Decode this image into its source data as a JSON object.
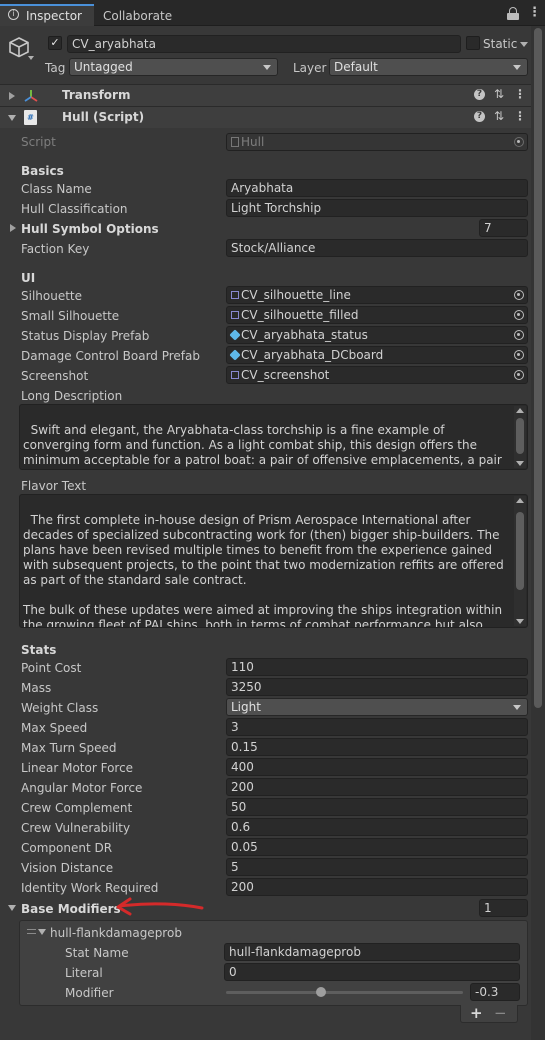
{
  "tabs": {
    "inspector": "Inspector",
    "collaborate": "Collaborate"
  },
  "object": {
    "name": "CV_aryabhata",
    "static_label": "Static",
    "tag_label": "Tag",
    "tag_value": "Untagged",
    "layer_label": "Layer",
    "layer_value": "Default"
  },
  "components": {
    "transform": "Transform",
    "hull_script": "Hull (Script)"
  },
  "script": {
    "label": "Script",
    "value": "Hull"
  },
  "basics": {
    "header": "Basics",
    "class_name_label": "Class Name",
    "class_name_value": "Aryabhata",
    "hull_class_label": "Hull Classification",
    "hull_class_value": "Light Torchship",
    "symbol_label": "Hull Symbol Options",
    "symbol_value": "7",
    "faction_label": "Faction Key",
    "faction_value": "Stock/Alliance"
  },
  "ui": {
    "header": "UI",
    "silhouette_label": "Silhouette",
    "silhouette_value": "CV_silhouette_line",
    "small_sil_label": "Small Silhouette",
    "small_sil_value": "CV_silhouette_filled",
    "status_label": "Status Display Prefab",
    "status_value": "CV_aryabhata_status",
    "dc_label": "Damage Control Board Prefab",
    "dc_value": "CV_aryabhata_DCboard",
    "screenshot_label": "Screenshot",
    "screenshot_value": "CV_screenshot",
    "long_desc_label": "Long Description",
    "long_desc_value": "Swift and elegant, the Aryabhata-class torchship is a fine example of converging form and function. As a light combat ship, this design offers the minimum acceptable for a patrol boat: a pair of offensive emplacements, a pair of utility ones and a whole lot of speed. An ideal ship for policing duties as the extreme angle of the hull will easily bounce off light calliber shots.",
    "flavor_label": "Flavor Text",
    "flavor_value": "The first complete in-house design of Prism Aerospace International after decades of specialized subcontracting work for (then) bigger ship-builders. The plans have been revised multiple times to benefit from the experience gained with subsequent projects, to the point that two modernization reffits are offered as part of the standard sale contract.\n\nThe bulk of these updates were aimed at improving the ships integration within the growing fleet of PAI ships, both in terms of combat performance but also maintenance through shared components and procedures. This makes the Aryabhatas quite"
  },
  "stats": {
    "header": "Stats",
    "rows": [
      {
        "label": "Point Cost",
        "value": "110"
      },
      {
        "label": "Mass",
        "value": "3250"
      },
      {
        "label": "Weight Class",
        "value": "Light"
      },
      {
        "label": "Max Speed",
        "value": "3"
      },
      {
        "label": "Max Turn Speed",
        "value": "0.15"
      },
      {
        "label": "Linear Motor Force",
        "value": "400"
      },
      {
        "label": "Angular Motor Force",
        "value": "200"
      },
      {
        "label": "Crew Complement",
        "value": "50"
      },
      {
        "label": "Crew Vulnerability",
        "value": "0.6"
      },
      {
        "label": "Component DR",
        "value": "0.05"
      },
      {
        "label": "Vision Distance",
        "value": "5"
      },
      {
        "label": "Identity Work Required",
        "value": "200"
      }
    ]
  },
  "base_modifiers": {
    "label": "Base Modifiers",
    "count": "1",
    "item_title": "hull-flankdamageprob",
    "stat_name_label": "Stat Name",
    "stat_name_value": "hull-flankdamageprob",
    "literal_label": "Literal",
    "literal_value": "0",
    "modifier_label": "Modifier",
    "modifier_value": "-0.3",
    "modifier_fraction": 0.4,
    "add": "+",
    "remove": "−"
  },
  "colors": {
    "annotation": "#d42a2a",
    "accent": "#4a90d9"
  }
}
